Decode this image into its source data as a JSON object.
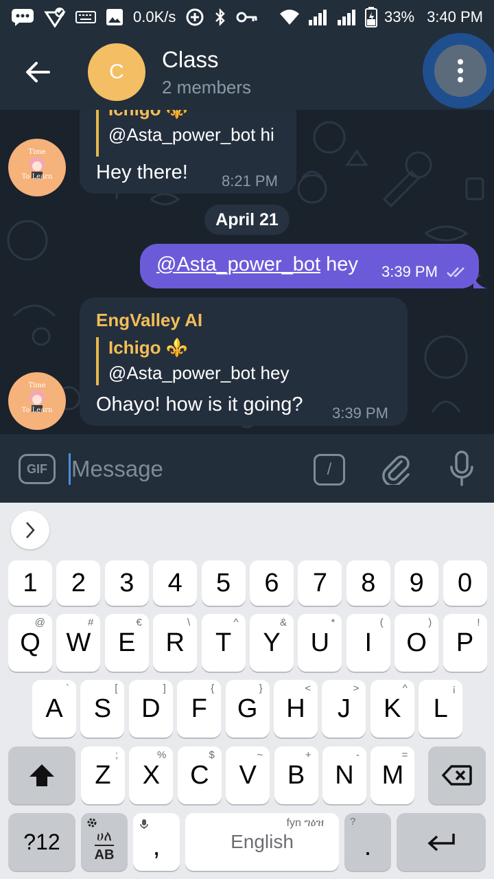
{
  "status_bar": {
    "speed": "0.0K/s",
    "battery": "33%",
    "time": "3:40 PM",
    "icons": [
      "message-icon",
      "check-icon",
      "keyboard-icon",
      "image-icon",
      "data-saver-icon",
      "bluetooth-icon",
      "key-icon",
      "wifi-icon",
      "signal-icon",
      "signal-icon",
      "battery-icon"
    ]
  },
  "header": {
    "avatar_letter": "C",
    "title": "Class",
    "subtitle": "2 members"
  },
  "chat": {
    "messages": [
      {
        "direction": "in",
        "reply_name": "Ichigo ⚜️",
        "reply_text": "@Asta_power_bot hi",
        "text": "Hey there!",
        "time": "8:21 PM",
        "avatar_line1": "Time",
        "avatar_line2": "To Learn"
      },
      {
        "direction": "out",
        "mention": "@Asta_power_bot",
        "text": " hey",
        "time": "3:39 PM"
      },
      {
        "direction": "in",
        "sender": "EngValley AI",
        "reply_name": "Ichigo ⚜️",
        "reply_text": "@Asta_power_bot hey",
        "text": "Ohayo! how is it going?",
        "time": "3:39 PM",
        "avatar_line1": "Time",
        "avatar_line2": "To Learn"
      }
    ],
    "date_separator": "April 21"
  },
  "input": {
    "gif_label": "GIF",
    "placeholder": "Message",
    "command_label": "/"
  },
  "keyboard": {
    "number_row": [
      "1",
      "2",
      "3",
      "4",
      "5",
      "6",
      "7",
      "8",
      "9",
      "0"
    ],
    "row1": [
      {
        "key": "Q",
        "hint": "@"
      },
      {
        "key": "W",
        "hint": "#"
      },
      {
        "key": "E",
        "hint": "€"
      },
      {
        "key": "R",
        "hint": "\\"
      },
      {
        "key": "T",
        "hint": "^"
      },
      {
        "key": "Y",
        "hint": "&"
      },
      {
        "key": "U",
        "hint": "*"
      },
      {
        "key": "I",
        "hint": "("
      },
      {
        "key": "O",
        "hint": ")"
      },
      {
        "key": "P",
        "hint": "!"
      }
    ],
    "row2": [
      {
        "key": "A",
        "hint": "`"
      },
      {
        "key": "S",
        "hint": "["
      },
      {
        "key": "D",
        "hint": "]"
      },
      {
        "key": "F",
        "hint": "{"
      },
      {
        "key": "G",
        "hint": "}"
      },
      {
        "key": "H",
        "hint": "<"
      },
      {
        "key": "J",
        "hint": ">"
      },
      {
        "key": "K",
        "hint": "^"
      },
      {
        "key": "L",
        "hint": "¡"
      }
    ],
    "row3": [
      {
        "key": "Z",
        "hint": ";"
      },
      {
        "key": "X",
        "hint": "%"
      },
      {
        "key": "C",
        "hint": "$"
      },
      {
        "key": "V",
        "hint": "~"
      },
      {
        "key": "B",
        "hint": "+"
      },
      {
        "key": "N",
        "hint": "-"
      },
      {
        "key": "M",
        "hint": "="
      }
    ],
    "symbols_key": "?12",
    "lang_top": "ሀለ",
    "lang_bottom": "AB",
    "comma": ",",
    "space_label": "English",
    "space_hint": "fyn ግዕዝ",
    "period": ".",
    "period_hint": "?"
  },
  "colors": {
    "header_bg": "#222e3a",
    "chat_bg": "#1a222c",
    "bubble_in": "#242f3d",
    "bubble_out": "#6c5bd9",
    "accent_name": "#f3be58",
    "avatar": "#f3be64"
  }
}
